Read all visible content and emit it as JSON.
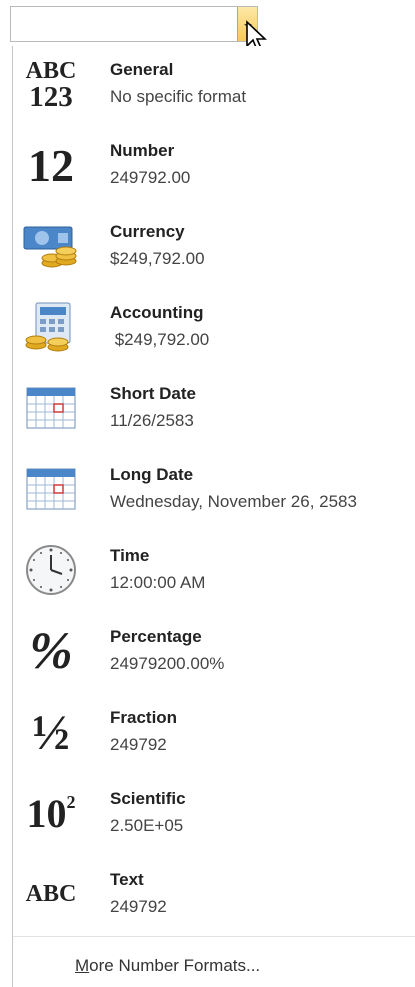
{
  "formats": [
    {
      "title": "General",
      "value": "No specific format",
      "icon": "abc-123-icon"
    },
    {
      "title": "Number",
      "value": "249792.00",
      "icon": "number-12-icon"
    },
    {
      "title": "Currency",
      "value": "$249,792.00",
      "icon": "currency-icon"
    },
    {
      "title": "Accounting",
      "value": " $249,792.00",
      "icon": "accounting-icon"
    },
    {
      "title": "Short Date",
      "value": "11/26/2583",
      "icon": "calendar-icon"
    },
    {
      "title": "Long Date",
      "value": "Wednesday, November 26, 2583",
      "icon": "calendar-icon"
    },
    {
      "title": "Time",
      "value": "12:00:00 AM",
      "icon": "clock-icon"
    },
    {
      "title": "Percentage",
      "value": "24979200.00%",
      "icon": "percent-icon"
    },
    {
      "title": "Fraction",
      "value": "249792",
      "icon": "fraction-icon"
    },
    {
      "title": "Scientific",
      "value": "2.50E+05",
      "icon": "scientific-icon"
    },
    {
      "title": "Text",
      "value": "249792",
      "icon": "text-abc-icon"
    }
  ],
  "icon_text": {
    "general_top": "ABC",
    "general_bottom": "123",
    "number": "12",
    "percent": "%",
    "fraction": "½",
    "scientific_base": "10",
    "scientific_exp": "2",
    "text": "ABC"
  },
  "more_first": "M",
  "more_rest": "ore Number Formats..."
}
